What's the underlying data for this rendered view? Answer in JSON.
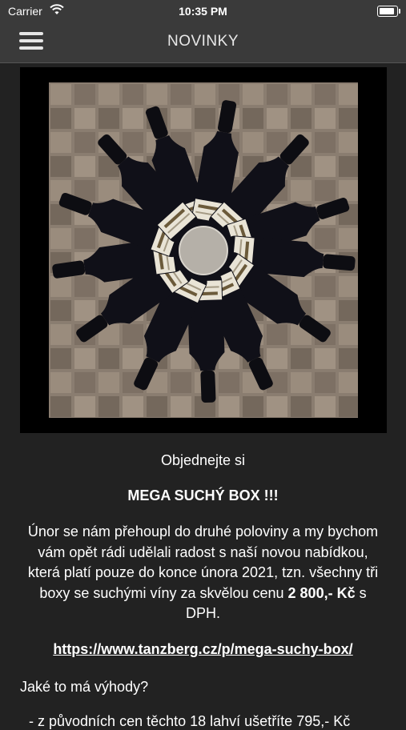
{
  "status_bar": {
    "carrier": "Carrier",
    "time": "10:35 PM"
  },
  "nav": {
    "title": "NOVINKY",
    "menu_icon": "hamburger-menu-icon"
  },
  "hero": {
    "icon": "wine-bottles-photo"
  },
  "article": {
    "line1": "Objednejte si",
    "headline": "MEGA SUCHÝ BOX !!!",
    "paragraph_part1": "Únor se nám přehoupl do druhé poloviny a my bychom vám opět rádi udělali radost s naší novou nabídkou, která platí pouze do konce února 2021, tzn. všechny tři boxy se suchými víny za skvělou cenu ",
    "price": "2 800,- Kč",
    "paragraph_part2": " s DPH.",
    "link": "https://www.tanzberg.cz/p/mega-suchy-box/",
    "question": "Jaké to má výhody?",
    "bullet": "- z původních cen těchto 18 lahví ušetříte 795,- Kč"
  }
}
